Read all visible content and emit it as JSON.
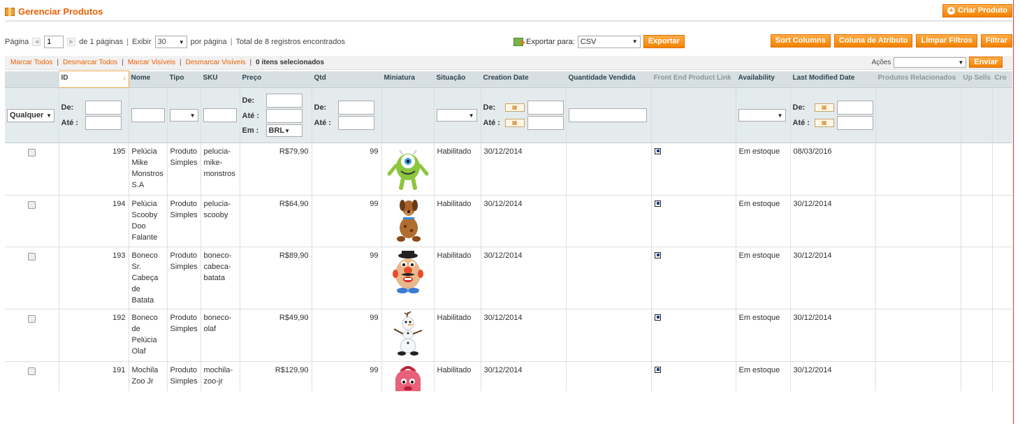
{
  "header": {
    "title": "Gerenciar Produtos",
    "create_label": "Criar Produto"
  },
  "pager": {
    "page_label": "Página",
    "page_value": "1",
    "of_pages": "de 1 páginas",
    "sep": "|",
    "show_label": "Exibir",
    "per_page": "30",
    "per_page_suffix": "por página",
    "total": "Total de 8 registros encontrados"
  },
  "export": {
    "label": "Exportar para:",
    "format": "CSV",
    "button": "Exportar"
  },
  "toolbar": {
    "sort_columns": "Sort Columns",
    "attr_column": "Coluna de Atributo",
    "clear_filters": "Limpar Filtros",
    "filter": "Filtrar"
  },
  "massaction": {
    "select_all": "Marcar Todos",
    "unselect_all": "Desmarcar Todos",
    "select_visible": "Marcar Visíveis",
    "unselect_visible": "Desmarcar Visíveis",
    "sep": "|",
    "selected": "0 itens selecionados",
    "actions_label": "Ações",
    "submit": "Enviar"
  },
  "columns": [
    "ID",
    "Nome",
    "Tipo",
    "SKU",
    "Preço",
    "Qtd",
    "Miniatura",
    "Situação",
    "Creation Date",
    "Quantidade Vendida",
    "Front End Product Link",
    "Availability",
    "Last Modified Date",
    "Produtos Relacionados",
    "Up Sells",
    "Cro"
  ],
  "filters": {
    "any": "Qualquer",
    "from": "De:",
    "to": "Até :",
    "to_short": "Até:",
    "in": "Em :",
    "currency": "BRL"
  },
  "rows": [
    {
      "id": "195",
      "name": "Pelúcia Mike Monstros S.A",
      "type": "Produto Simples",
      "sku": "pelucia-mike-monstros",
      "price": "R$79,90",
      "qty": "99",
      "thumb": "mike-wazowski-plush",
      "status": "Habilitado",
      "created": "30/12/2014",
      "availability": "Em estoque",
      "modified": "08/03/2016"
    },
    {
      "id": "194",
      "name": "Pelúcia Scooby Doo Falante",
      "type": "Produto Simples",
      "sku": "pelucia-scooby",
      "price": "R$64,90",
      "qty": "99",
      "thumb": "scooby-doo-plush",
      "status": "Habilitado",
      "created": "30/12/2014",
      "availability": "Em estoque",
      "modified": "30/12/2014"
    },
    {
      "id": "193",
      "name": "Boneco Sr. Cabeça de Batata",
      "type": "Produto Simples",
      "sku": "boneco-cabeca-batata",
      "price": "R$89,90",
      "qty": "99",
      "thumb": "mr-potato-head",
      "status": "Habilitado",
      "created": "30/12/2014",
      "availability": "Em estoque",
      "modified": "30/12/2014"
    },
    {
      "id": "192",
      "name": "Boneco de Pelúcia Olaf",
      "type": "Produto Simples",
      "sku": "boneco-olaf",
      "price": "R$49,90",
      "qty": "99",
      "thumb": "olaf-plush",
      "status": "Habilitado",
      "created": "30/12/2014",
      "availability": "Em estoque",
      "modified": "30/12/2014"
    },
    {
      "id": "191",
      "name": "Mochila Zoo Jr",
      "type": "Produto Simples",
      "sku": "mochila-zoo-jr",
      "price": "R$129,90",
      "qty": "99",
      "thumb": "pink-backpack",
      "status": "Habilitado",
      "created": "30/12/2014",
      "availability": "Em estoque",
      "modified": "30/12/2014"
    }
  ]
}
